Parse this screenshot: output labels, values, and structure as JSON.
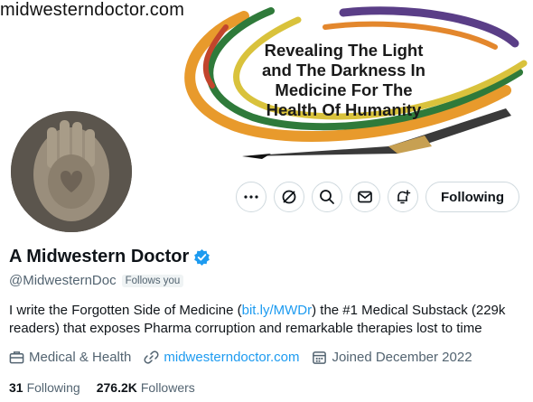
{
  "banner": {
    "site_text": "midwesterndoctor.com",
    "tagline": "Revealing The Light\nand The Darkness In\nMedicine For The\nHealth Of Humanity"
  },
  "actions": {
    "more_icon": "more-dots-icon",
    "grok_icon": "grok-icon",
    "search_icon": "search-icon",
    "message_icon": "mail-icon",
    "notify_icon": "bell-plus-icon",
    "following_label": "Following"
  },
  "profile": {
    "display_name": "A Midwestern Doctor",
    "handle": "@MidwesternDoc",
    "follows_you": "Follows you",
    "bio_part1": "I write the Forgotten Side of Medicine (",
    "bio_link": "bit.ly/MWDr",
    "bio_part2": ") the #1 Medical Substack (229k readers) that exposes Pharma corruption and remarkable therapies lost to time",
    "category": "Medical & Health",
    "website": "midwesterndoctor.com",
    "joined": "Joined December 2022",
    "following_count": "31",
    "following_label": "Following",
    "followers_count": "276.2K",
    "followers_label": "Followers"
  },
  "colors": {
    "accent": "#1d9bf0",
    "text": "#0f1419",
    "muted": "#536471",
    "border": "#cfd9de"
  }
}
